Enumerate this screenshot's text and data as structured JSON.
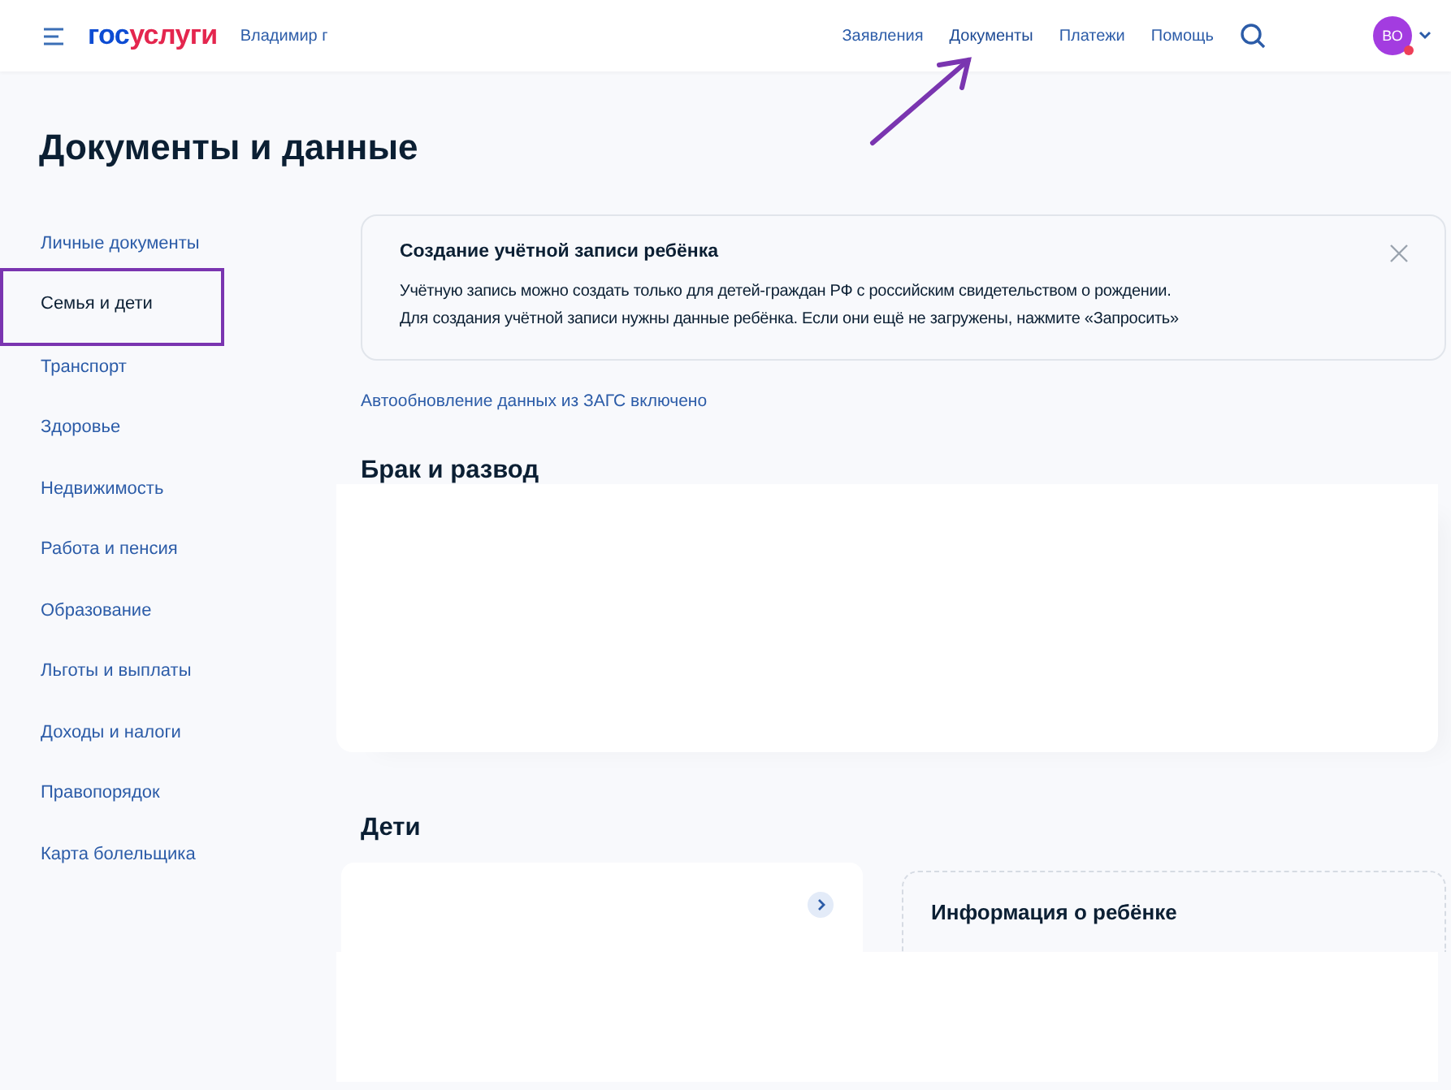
{
  "header": {
    "logo_left": "гос",
    "logo_right": "услуги",
    "user_name": "Владимир г",
    "nav": [
      {
        "label": "Заявления",
        "highlighted": false
      },
      {
        "label": "Документы",
        "highlighted": true
      },
      {
        "label": "Платежи",
        "highlighted": false
      },
      {
        "label": "Помощь",
        "highlighted": false
      }
    ],
    "avatar": "ВО"
  },
  "page_title": "Документы и данные",
  "sidebar": {
    "items": [
      {
        "label": "Личные документы",
        "selected": false
      },
      {
        "label": "Семья и дети",
        "selected": true
      },
      {
        "label": "Транспорт",
        "selected": false
      },
      {
        "label": "Здоровье",
        "selected": false
      },
      {
        "label": "Недвижимость",
        "selected": false
      },
      {
        "label": "Работа и пенсия",
        "selected": false
      },
      {
        "label": "Образование",
        "selected": false
      },
      {
        "label": "Льготы и выплаты",
        "selected": false
      },
      {
        "label": "Доходы и налоги",
        "selected": false
      },
      {
        "label": "Правопорядок",
        "selected": false
      },
      {
        "label": "Карта болельщика",
        "selected": false
      }
    ]
  },
  "notice": {
    "title": "Создание учётной записи ребёнка",
    "lines": [
      "Учётную запись можно создать только для детей-граждан РФ с российским свидетельством о рождении.",
      "Для создания учётной записи нужны данные ребёнка. Если они ещё не загружены, нажмите «Запросить»"
    ]
  },
  "autoupdate_link": "Автообновление данных из ЗАГС включено",
  "sections": [
    {
      "title": "Брак и развод"
    },
    {
      "title": "Дети",
      "info_card": "Информация о ребёнке"
    }
  ]
}
